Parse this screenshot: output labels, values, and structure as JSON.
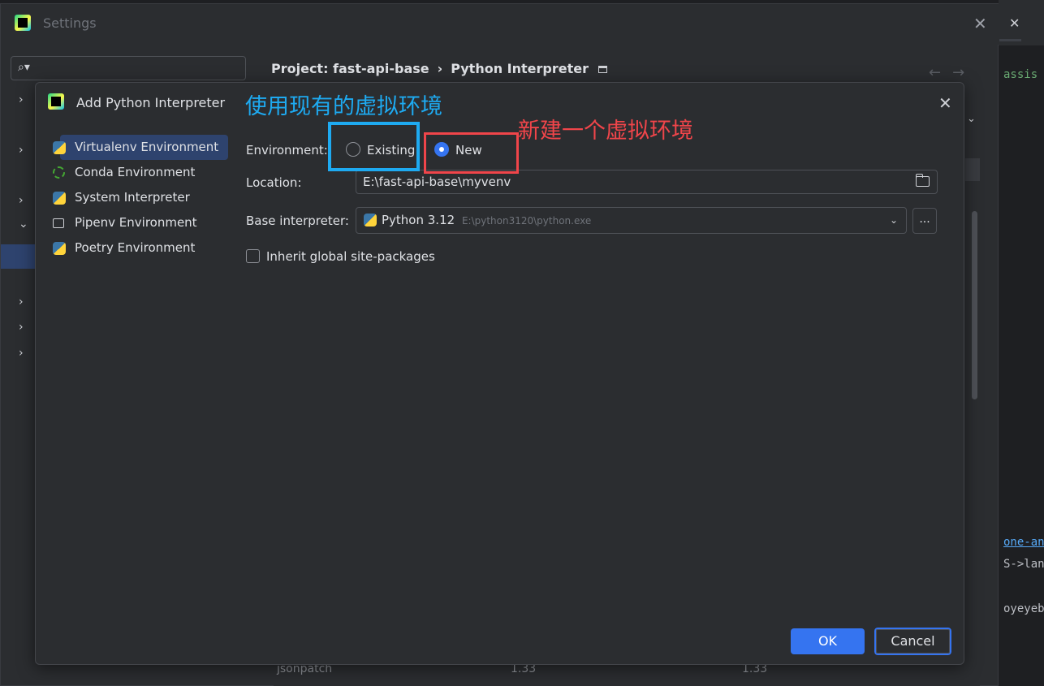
{
  "settings": {
    "title": "Settings",
    "close_glyph": "✕",
    "search_glyph": "⌕▾",
    "breadcrumb": {
      "project": "Project: fast-api-base",
      "separator": "›",
      "page": "Python Interpreter"
    },
    "nav_back": "←",
    "nav_forward": "→",
    "tree_chevron_right": "›",
    "tree_chevron_down": "⌄",
    "bottom_row": {
      "package": "jsonpatch",
      "version": "1.33",
      "latest": "1.33"
    }
  },
  "editor": {
    "tab_close": "✕",
    "lines": [
      "assis",
      "one-any",
      "S->lang",
      "oyeyeba"
    ]
  },
  "dialog": {
    "title": "Add Python Interpreter",
    "close_glyph": "✕",
    "environments": [
      {
        "label": "Virtualenv Environment",
        "icon": "virtualenv-icon",
        "selected": true
      },
      {
        "label": "Conda Environment",
        "icon": "conda-icon",
        "selected": false
      },
      {
        "label": "System Interpreter",
        "icon": "python-icon",
        "selected": false
      },
      {
        "label": "Pipenv Environment",
        "icon": "pipenv-icon",
        "selected": false
      },
      {
        "label": "Poetry Environment",
        "icon": "poetry-icon",
        "selected": false
      }
    ],
    "form": {
      "environment_label": "Environment:",
      "option_existing": "Existing",
      "option_new": "New",
      "selected_option": "New",
      "location_label": "Location:",
      "location_value": "E:\\fast-api-base\\myvenv",
      "base_label": "Base interpreter:",
      "base_version": "Python 3.12",
      "base_path": "E:\\python3120\\python.exe",
      "browse_label": "...",
      "inherit_label": "Inherit global site-packages",
      "inherit_checked": false
    },
    "buttons": {
      "ok": "OK",
      "cancel": "Cancel"
    }
  },
  "annotations": {
    "existing_note": "使用现有的虚拟环境",
    "new_note": "新建一个虚拟环境",
    "colors": {
      "blue": "#1eaaf1",
      "red": "#f0454a"
    }
  },
  "colors": {
    "accent": "#3574f0",
    "selection": "#2e436e",
    "background": "#2b2d30"
  }
}
